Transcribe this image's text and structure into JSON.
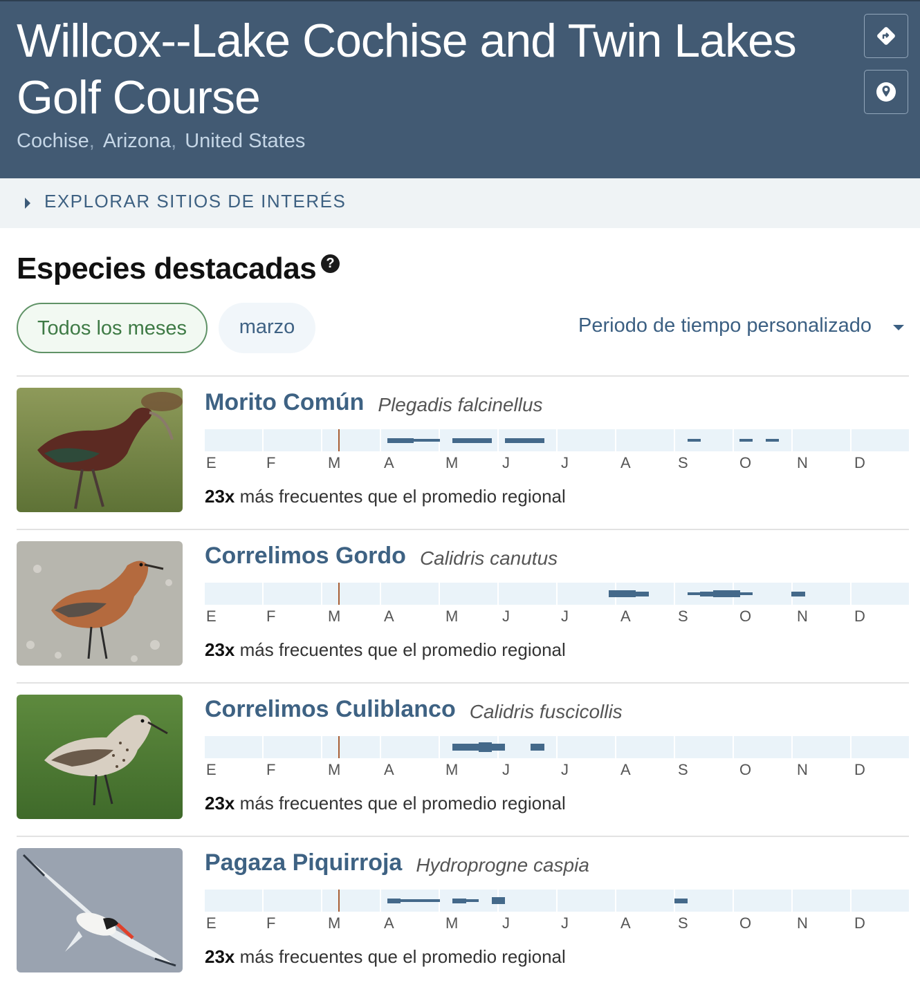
{
  "header": {
    "title": "Willcox--Lake Cochise and Twin Lakes Golf Course",
    "region": [
      "Cochise",
      "Arizona",
      "United States"
    ],
    "region_separator": ",",
    "buttons": [
      {
        "name": "directions",
        "icon": "directions-icon"
      },
      {
        "name": "map",
        "icon": "map-pin-icon"
      }
    ]
  },
  "explore": {
    "label": "EXPLORAR SITIOS DE INTERÉS"
  },
  "section": {
    "title": "Especies destacadas",
    "help": "?"
  },
  "filters": {
    "all_months": "Todos los meses",
    "current_month": "marzo",
    "custom_period": "Periodo de tiempo personalizado"
  },
  "months": [
    "E",
    "F",
    "M",
    "A",
    "M",
    "J",
    "J",
    "A",
    "S",
    "O",
    "N",
    "D"
  ],
  "colors": {
    "header_bg": "#425a73",
    "bar_fill": "#44698a",
    "bar_bg": "#eaf3f9",
    "current_marker": "#a85e34",
    "active_pill": "#3e7a45",
    "link": "#3e6283"
  },
  "species": [
    {
      "common_name": "Morito Común",
      "scientific_name": "Plegadis falcinellus",
      "photo_icon": "glossy-ibis-photo",
      "freq_value": "23x",
      "freq_text": "más frecuentes que el promedio regional",
      "weekly_frequency": [
        0,
        0,
        0,
        0,
        0,
        0,
        0,
        0,
        0,
        0,
        0,
        0,
        0,
        0,
        2,
        2,
        1,
        1,
        0,
        2,
        2,
        2,
        0,
        2,
        2,
        2,
        0,
        0,
        0,
        0,
        0,
        0,
        0,
        0,
        0,
        0,
        0,
        1,
        0,
        0,
        0,
        1,
        0,
        1,
        0,
        0,
        0,
        0,
        0,
        0,
        0,
        0,
        0,
        0
      ]
    },
    {
      "common_name": "Correlimos Gordo",
      "scientific_name": "Calidris canutus",
      "photo_icon": "red-knot-photo",
      "freq_value": "23x",
      "freq_text": "más frecuentes que el promedio regional",
      "weekly_frequency": [
        0,
        0,
        0,
        0,
        0,
        0,
        0,
        0,
        0,
        0,
        0,
        0,
        0,
        0,
        0,
        0,
        0,
        0,
        0,
        0,
        0,
        0,
        0,
        0,
        0,
        0,
        0,
        0,
        0,
        0,
        0,
        3,
        3,
        2,
        0,
        0,
        0,
        1,
        2,
        3,
        3,
        1,
        0,
        0,
        0,
        2,
        0,
        0,
        0,
        0,
        0,
        0,
        0,
        0
      ]
    },
    {
      "common_name": "Correlimos Culiblanco",
      "scientific_name": "Calidris fuscicollis",
      "photo_icon": "white-rumped-sandpiper-photo",
      "freq_value": "23x",
      "freq_text": "más frecuentes que el promedio regional",
      "weekly_frequency": [
        0,
        0,
        0,
        0,
        0,
        0,
        0,
        0,
        0,
        0,
        0,
        0,
        0,
        0,
        0,
        0,
        0,
        0,
        0,
        3,
        3,
        4,
        3,
        0,
        0,
        3,
        0,
        0,
        0,
        0,
        0,
        0,
        0,
        0,
        0,
        0,
        0,
        0,
        0,
        0,
        0,
        0,
        0,
        0,
        0,
        0,
        0,
        0,
        0,
        0,
        0,
        0,
        0,
        0
      ]
    },
    {
      "common_name": "Pagaza Piquirroja",
      "scientific_name": "Hydroprogne caspia",
      "photo_icon": "caspian-tern-photo",
      "freq_value": "23x",
      "freq_text": "más frecuentes que el promedio regional",
      "weekly_frequency": [
        0,
        0,
        0,
        0,
        0,
        0,
        0,
        0,
        0,
        0,
        0,
        0,
        0,
        0,
        2,
        1,
        1,
        1,
        0,
        2,
        1,
        0,
        3,
        0,
        0,
        0,
        0,
        0,
        0,
        0,
        0,
        0,
        0,
        0,
        0,
        0,
        2,
        0,
        0,
        0,
        0,
        0,
        0,
        0,
        0,
        0,
        0,
        0,
        0,
        0,
        0,
        0,
        0,
        0
      ]
    }
  ]
}
